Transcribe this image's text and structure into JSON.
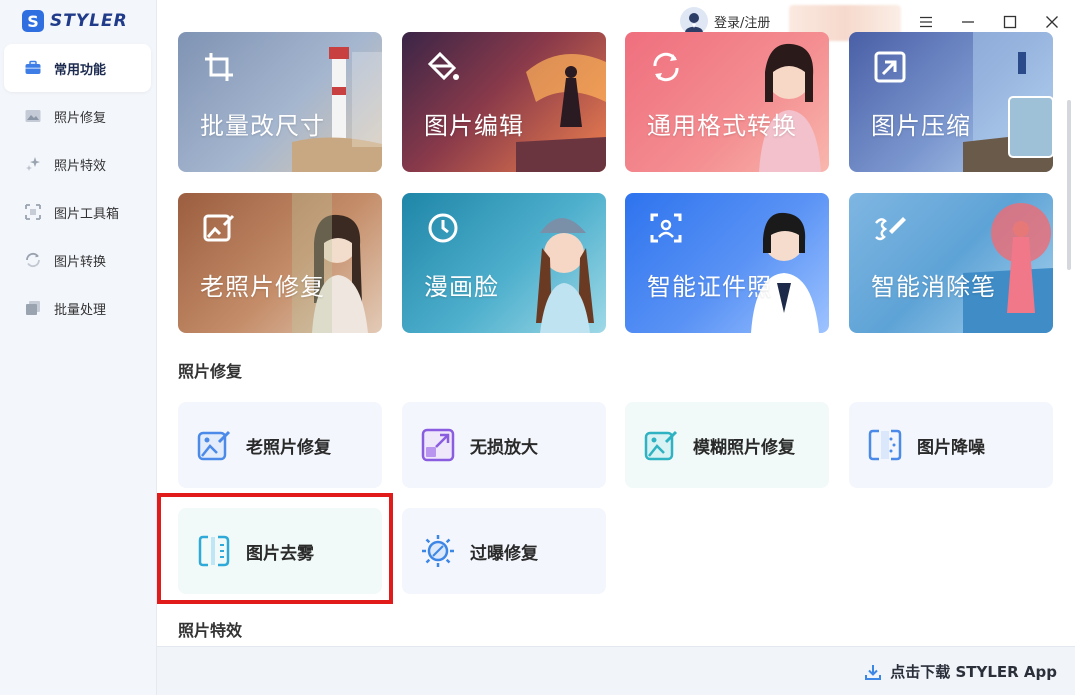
{
  "app": {
    "name": "STYLER",
    "logo_letter": "S"
  },
  "sidebar": {
    "items": [
      {
        "label": "常用功能",
        "icon": "briefcase-icon",
        "active": true
      },
      {
        "label": "照片修复",
        "icon": "image-icon",
        "active": false
      },
      {
        "label": "照片特效",
        "icon": "sparkles-icon",
        "active": false
      },
      {
        "label": "图片工具箱",
        "icon": "toolbox-icon",
        "active": false
      },
      {
        "label": "图片转换",
        "icon": "convert-icon",
        "active": false
      },
      {
        "label": "批量处理",
        "icon": "batch-icon",
        "active": false
      }
    ]
  },
  "topbar": {
    "login_label": "登录/注册"
  },
  "feature_cards": [
    {
      "label": "批量改尺寸",
      "icon": "crop-icon",
      "color_from": "#8a9cb8",
      "color_to": "#c9d4e4"
    },
    {
      "label": "图片编辑",
      "icon": "paint-bucket-icon",
      "color_from": "#5a2a4a",
      "color_to": "#e7694b"
    },
    {
      "label": "通用格式转换",
      "icon": "refresh-icon",
      "color_from": "#f07f86",
      "color_to": "#f7a6a0"
    },
    {
      "label": "图片压缩",
      "icon": "compress-icon",
      "color_from": "#5d6fb2",
      "color_to": "#9ec1e6"
    },
    {
      "label": "老照片修复",
      "icon": "photo-repair-icon",
      "color_from": "#a9704f",
      "color_to": "#d5a983"
    },
    {
      "label": "漫画脸",
      "icon": "clock-icon",
      "color_from": "#2d8fb0",
      "color_to": "#7fc6d8"
    },
    {
      "label": "智能证件照",
      "icon": "id-photo-icon",
      "color_from": "#3d7ff0",
      "color_to": "#7fb1ff"
    },
    {
      "label": "智能消除笔",
      "icon": "eraser-pen-icon",
      "color_from": "#9fc9ea",
      "color_to": "#5fa6d6"
    }
  ],
  "sections": {
    "photo_repair": "照片修复",
    "photo_effects": "照片特效"
  },
  "tools": [
    {
      "label": "老照片修复",
      "icon": "old-photo-icon"
    },
    {
      "label": "无损放大",
      "icon": "upscale-icon"
    },
    {
      "label": "模糊照片修复",
      "icon": "blur-fix-icon"
    },
    {
      "label": "图片降噪",
      "icon": "denoise-icon"
    },
    {
      "label": "图片去雾",
      "icon": "dehaze-icon"
    },
    {
      "label": "过曝修复",
      "icon": "exposure-icon"
    }
  ],
  "bottombar": {
    "download_label": "点击下载 STYLER App"
  },
  "colors": {
    "accent": "#2f6fe0",
    "highlight": "#e11a1a"
  }
}
